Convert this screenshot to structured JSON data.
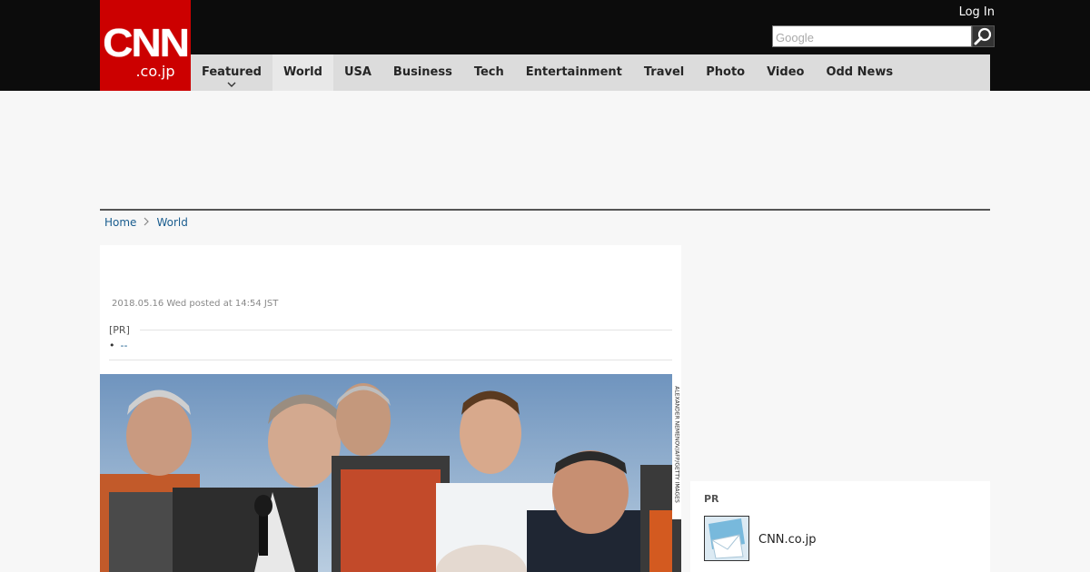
{
  "header": {
    "logo_main": "CNN",
    "logo_sub": ".co.jp",
    "login_label": "Log In",
    "search_placeholder": "Google"
  },
  "nav": {
    "items": [
      {
        "label": "Featured"
      },
      {
        "label": "World"
      },
      {
        "label": "USA"
      },
      {
        "label": "Business"
      },
      {
        "label": "Tech"
      },
      {
        "label": "Entertainment"
      },
      {
        "label": "Travel"
      },
      {
        "label": "Photo"
      },
      {
        "label": "Video"
      },
      {
        "label": "Odd News"
      }
    ],
    "active": "World"
  },
  "breadcrumb": {
    "home": "Home",
    "section": "World"
  },
  "article": {
    "timestamp": "2018.05.16 Wed posted at 14:54 JST",
    "pr_label": "[PR]",
    "pr_link_bullet": "•",
    "pr_link_text": "--",
    "photo_credit": "ALEXANDER NEMENOV/AFP/GETTY IMAGES"
  },
  "sidebar": {
    "title": "PR",
    "item_name": "CNN.co.jp"
  },
  "colors": {
    "brand_red": "#cc0000",
    "topbar": "#0c0c0c",
    "nav_bg": "#dcdcdc",
    "link": "#1a5d8f"
  }
}
